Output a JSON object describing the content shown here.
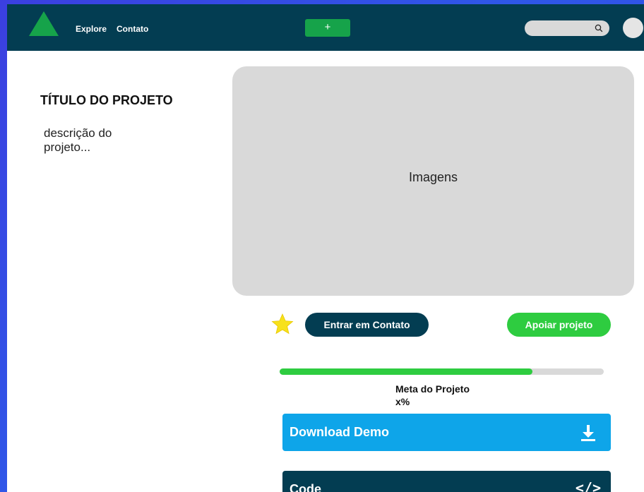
{
  "nav": {
    "explore": "Explore",
    "contato": "Contato",
    "add_label": "+"
  },
  "project": {
    "title": "TÍTULO DO PROJETO",
    "description": "descrição do projeto..."
  },
  "media": {
    "placeholder": "Imagens"
  },
  "actions": {
    "contact": "Entrar em Contato",
    "support": "Apoiar projeto"
  },
  "goal": {
    "label": "Meta do Projeto",
    "value_text": "x%",
    "progress": 0.78
  },
  "download": {
    "label": "Download Demo"
  },
  "code": {
    "label": "Code",
    "icon": "</>"
  },
  "colors": {
    "navbar": "#033d52",
    "brand_green": "#16a34a",
    "accent_green": "#2ecc40",
    "download_blue": "#0ea5e9",
    "star_yellow": "#f7e11b"
  }
}
